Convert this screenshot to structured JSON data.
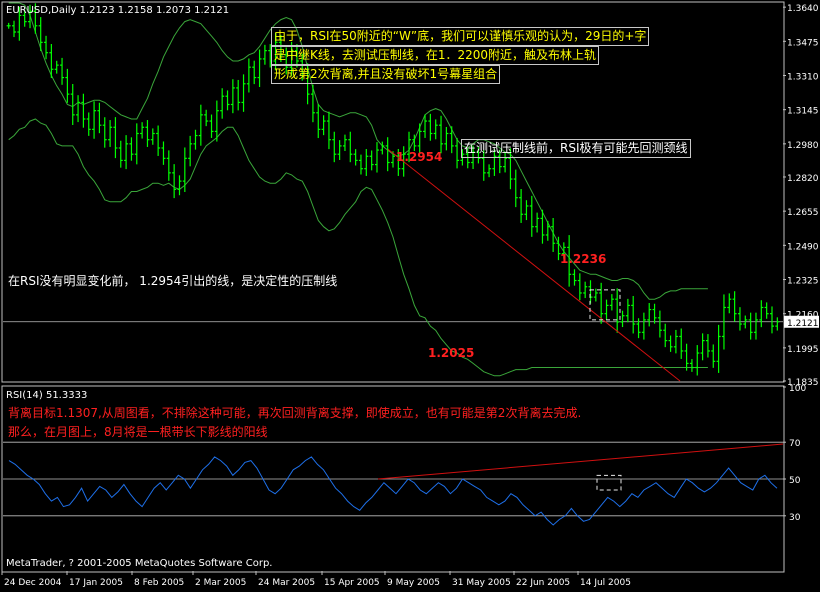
{
  "colors": {
    "background": "#000000",
    "panel_border": "#c0c0c0",
    "bar": "#00ff00",
    "bands": "#3aa63a",
    "trendline": "#d01010",
    "rsi_line": "#1e6fe8",
    "annotation_yellow": "#ffff00",
    "annotation_red": "#ff2020",
    "annotation_white": "#ffffff",
    "price_label_bg": "#ffffff",
    "price_label_fg": "#000000"
  },
  "header": {
    "main": "EURUSD,Daily  1.2123 1.2158 1.2073 1.2121",
    "rsi": "RSI(14) 51.3333"
  },
  "footer": {
    "copyright": "MetaTrader, ? 2001-2005 MetaQuotes Software Corp."
  },
  "annotations": {
    "top_line1": "由于，RSI在50附近的“W”底，我们可以谨慎乐观的认为，29日的+字",
    "top_line2": "是中继K线，去测试压制线，在1．2200附近，触及布林上轨",
    "top_line3": "形成第2次背离,并且没有破坏1号幕星组合",
    "right_note": "在测试压制线前，RSI极有可能先回测颈线",
    "left_note": "在RSI没有明显变化前，  1.2954引出的线，是决定性的压制线",
    "level_1": "1.2954",
    "level_2": "1.2236",
    "level_3": "1.2025",
    "rsi_note1": "背离目标1.1307,从周图看，不排除这种可能，再次回测背离支撑，即使成立，也有可能是第2次背离去完成.",
    "rsi_note2": "那么，在月图上，8月将是一根带长下影线的阳线"
  },
  "chart_data": [
    {
      "type": "candlestick",
      "symbol": "EURUSD",
      "timeframe": "Daily",
      "title": "EURUSD,Daily  1.2123 1.2158 1.2073 1.2121",
      "last_price": "1.2121",
      "ylim": [
        1.1835,
        1.366
      ],
      "y_ticks": [
        "1.3640",
        "1.3475",
        "1.3310",
        "1.3145",
        "1.2980",
        "1.2820",
        "1.2655",
        "1.2490",
        "1.2325",
        "1.2160",
        "1.1995",
        "1.1835"
      ],
      "x_tick_labels": [
        "24 Dec 2004",
        "17 Jan 2005",
        "8 Feb 2005",
        "2 Mar 2005",
        "24 Mar 2005",
        "15 Apr 2005",
        "9 May 2005",
        "31 May 2005",
        "22 Jun 2005",
        "14 Jul 2005"
      ],
      "closes": [
        1.355,
        1.352,
        1.36,
        1.357,
        1.362,
        1.355,
        1.347,
        1.342,
        1.334,
        1.336,
        1.33,
        1.322,
        1.312,
        1.318,
        1.31,
        1.305,
        1.314,
        1.307,
        1.3,
        1.306,
        1.296,
        1.29,
        1.298,
        1.293,
        1.303,
        1.306,
        1.3,
        1.303,
        1.296,
        1.291,
        1.284,
        1.276,
        1.28,
        1.291,
        1.298,
        1.302,
        1.312,
        1.309,
        1.304,
        1.314,
        1.321,
        1.317,
        1.325,
        1.318,
        1.327,
        1.335,
        1.33,
        1.339,
        1.343,
        1.338,
        1.347,
        1.341,
        1.335,
        1.343,
        1.338,
        1.332,
        1.322,
        1.313,
        1.305,
        1.309,
        1.3,
        1.293,
        1.297,
        1.3,
        1.293,
        1.29,
        1.286,
        1.292,
        1.288,
        1.295,
        1.297,
        1.289,
        1.292,
        1.286,
        1.293,
        1.3,
        1.297,
        1.304,
        1.309,
        1.303,
        1.307,
        1.298,
        1.303,
        1.297,
        1.29,
        1.293,
        1.289,
        1.294,
        1.291,
        1.284,
        1.286,
        1.292,
        1.287,
        1.291,
        1.281,
        1.272,
        1.264,
        1.268,
        1.258,
        1.262,
        1.254,
        1.258,
        1.25,
        1.245,
        1.248,
        1.235,
        1.232,
        1.226,
        1.229,
        1.224,
        1.226,
        1.216,
        1.22,
        1.223,
        1.212,
        1.215,
        1.22,
        1.211,
        1.207,
        1.213,
        1.218,
        1.214,
        1.208,
        1.203,
        1.2,
        1.205,
        1.198,
        1.192,
        1.19,
        1.197,
        1.203,
        1.198,
        1.193,
        1.205,
        1.219,
        1.223,
        1.216,
        1.211,
        1.213,
        1.207,
        1.213,
        1.219,
        1.216,
        1.21,
        1.2121
      ],
      "bollinger_bands": {
        "upper": [
          1.366,
          1.366,
          1.366,
          1.365,
          1.36,
          1.352,
          1.344,
          1.337,
          1.331,
          1.326,
          1.322,
          1.317,
          1.316,
          1.318,
          1.317,
          1.318,
          1.319,
          1.319,
          1.318,
          1.316,
          1.314,
          1.312,
          1.311,
          1.31,
          1.31,
          1.315,
          1.32,
          1.327,
          1.333,
          1.34,
          1.345,
          1.35,
          1.354,
          1.357,
          1.358,
          1.357,
          1.356,
          1.353,
          1.35,
          1.347,
          1.343,
          1.34,
          1.338,
          1.338,
          1.339,
          1.341,
          1.342,
          1.345,
          1.349,
          1.353,
          1.356,
          1.358,
          1.359,
          1.358,
          1.353,
          1.345,
          1.335,
          1.325,
          1.317,
          1.314,
          1.313,
          1.312,
          1.311,
          1.312,
          1.313,
          1.313,
          1.312,
          1.311,
          1.307,
          1.3,
          1.297,
          1.295,
          1.293,
          1.292,
          1.293,
          1.295,
          1.3,
          1.306,
          1.312,
          1.314,
          1.315,
          1.314,
          1.31,
          1.305,
          1.3,
          1.297,
          1.296,
          1.298,
          1.3,
          1.3,
          1.299,
          1.298,
          1.296,
          1.294,
          1.293,
          1.29,
          1.285,
          1.28,
          1.275,
          1.27,
          1.265,
          1.26,
          1.255,
          1.25,
          1.246,
          1.243,
          1.24,
          1.237,
          1.236,
          1.235,
          1.235,
          1.234,
          1.233,
          1.232,
          1.232,
          1.233,
          1.233,
          1.232,
          1.23,
          1.226,
          1.223,
          1.223,
          1.224,
          1.226,
          1.227,
          1.227,
          1.228,
          1.228,
          1.228,
          1.228,
          1.228,
          1.228
        ],
        "lower": [
          1.3,
          1.302,
          1.305,
          1.306,
          1.309,
          1.31,
          1.308,
          1.307,
          1.303,
          1.298,
          1.297,
          1.297,
          1.297,
          1.293,
          1.287,
          1.283,
          1.28,
          1.276,
          1.271,
          1.27,
          1.27,
          1.27,
          1.272,
          1.275,
          1.275,
          1.276,
          1.277,
          1.279,
          1.279,
          1.278,
          1.279,
          1.277,
          1.276,
          1.278,
          1.281,
          1.287,
          1.293,
          1.297,
          1.299,
          1.301,
          1.304,
          1.306,
          1.306,
          1.302,
          1.296,
          1.29,
          1.286,
          1.282,
          1.28,
          1.279,
          1.279,
          1.281,
          1.284,
          1.283,
          1.281,
          1.28,
          1.275,
          1.268,
          1.261,
          1.258,
          1.256,
          1.257,
          1.26,
          1.264,
          1.267,
          1.27,
          1.275,
          1.277,
          1.276,
          1.271,
          1.266,
          1.26,
          1.253,
          1.244,
          1.235,
          1.228,
          1.22,
          1.215,
          1.214,
          1.21,
          1.208,
          1.204,
          1.201,
          1.198,
          1.197,
          1.195,
          1.194,
          1.192,
          1.19,
          1.188,
          1.187,
          1.186,
          1.186,
          1.187,
          1.188,
          1.189,
          1.189,
          1.189,
          1.19,
          1.19,
          1.19,
          1.19,
          1.19,
          1.19,
          1.19,
          1.19,
          1.19,
          1.19,
          1.19,
          1.19,
          1.19,
          1.19,
          1.19,
          1.19,
          1.19,
          1.19,
          1.19,
          1.19,
          1.19,
          1.19,
          1.19,
          1.19,
          1.19,
          1.19,
          1.19,
          1.19,
          1.19,
          1.19,
          1.19,
          1.19,
          1.19,
          1.19
        ]
      },
      "trendline_from_level": "1.2954"
    },
    {
      "type": "line",
      "title": "RSI(14) 51.3333",
      "indicator": "RSI(14)",
      "last_value": 51.3333,
      "ylim": [
        0,
        100
      ],
      "y_ticks": [
        "100",
        "70",
        "50",
        "30"
      ],
      "series": [
        {
          "values": [
            60,
            58,
            55,
            52,
            50,
            47,
            42,
            38,
            40,
            35,
            36,
            40,
            45,
            38,
            42,
            46,
            44,
            40,
            43,
            47,
            42,
            38,
            35,
            40,
            45,
            48,
            44,
            48,
            52,
            50,
            45,
            50,
            55,
            58,
            62,
            60,
            57,
            52,
            55,
            59,
            60,
            56,
            50,
            44,
            42,
            45,
            50,
            55,
            57,
            60,
            62,
            58,
            55,
            50,
            45,
            42,
            38,
            35,
            33,
            37,
            40,
            44,
            48,
            45,
            42,
            46,
            50,
            48,
            44,
            42,
            45,
            48,
            46,
            42,
            45,
            50,
            48,
            46,
            44,
            40,
            38,
            36,
            38,
            42,
            40,
            36,
            33,
            30,
            32,
            28,
            25,
            28,
            30,
            34,
            30,
            27,
            28,
            32,
            36,
            40,
            38,
            35,
            38,
            42,
            40,
            44,
            46,
            48,
            45,
            42,
            40,
            45,
            50,
            48,
            45,
            43,
            45,
            48,
            52,
            56,
            52,
            48,
            46,
            44,
            50,
            52,
            48,
            45
          ]
        }
      ]
    }
  ]
}
